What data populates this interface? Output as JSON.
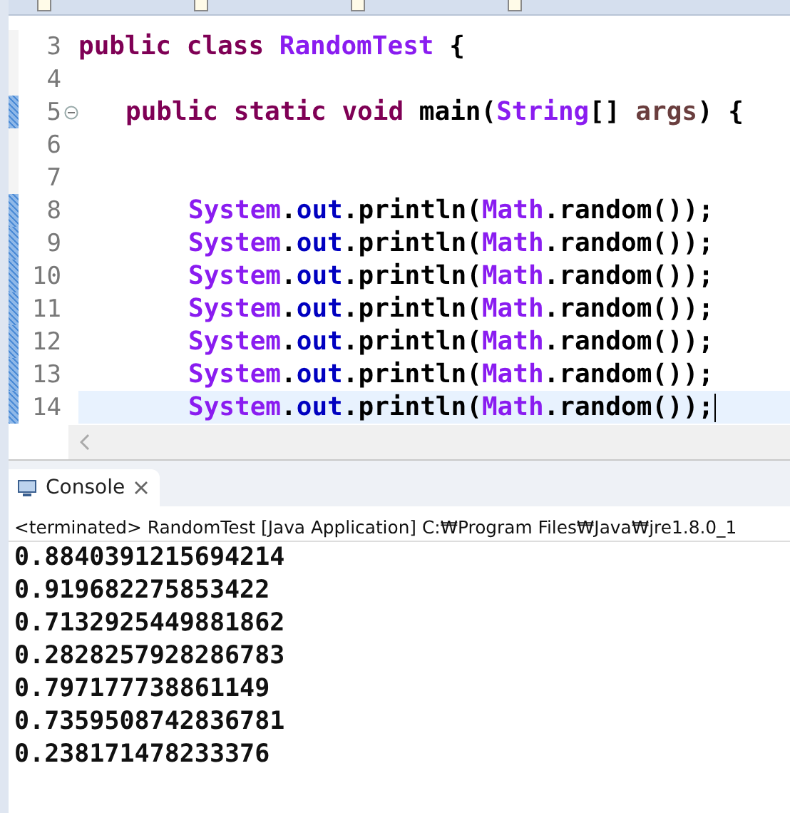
{
  "editor": {
    "lines": [
      {
        "number": "3",
        "changed": false,
        "fold": false,
        "current": false,
        "tokens": [
          {
            "text": "public",
            "kind": "keyword",
            "gap": false
          },
          {
            "text": "class",
            "kind": "keyword",
            "gap": true
          },
          {
            "text": "RandomTest",
            "kind": "type",
            "gap": true
          },
          {
            "text": "{",
            "kind": "plain",
            "gap": true
          }
        ],
        "children": [
          {
            "number": "4",
            "changed": false,
            "fold": false,
            "current": false
          },
          {
            "number": "5",
            "changed": true,
            "fold": true,
            "current": false,
            "tokens": [
              {
                "text": "public",
                "kind": "keyword",
                "gap": false
              },
              {
                "text": "static",
                "kind": "keyword",
                "gap": true
              },
              {
                "text": "void",
                "kind": "keyword",
                "gap": true
              },
              {
                "text": "main(",
                "kind": "plain",
                "gap": true
              },
              {
                "text": "String",
                "kind": "type",
                "gap": false
              },
              {
                "text": "[]",
                "kind": "plain",
                "gap": false
              },
              {
                "text": "args",
                "kind": "param",
                "gap": true
              },
              {
                "text": ")",
                "kind": "plain",
                "gap": false
              },
              {
                "text": "{",
                "kind": "plain",
                "gap": true
              }
            ],
            "children": [
              {
                "number": "6",
                "changed": false,
                "fold": false,
                "current": false
              },
              {
                "number": "7",
                "changed": false,
                "fold": false,
                "current": false
              },
              {
                "number": "8",
                "changed": true,
                "fold": false,
                "current": false,
                "tokens": [
                  {
                    "text": "System",
                    "kind": "type",
                    "gap": false
                  },
                  {
                    "text": ".",
                    "kind": "plain",
                    "gap": false
                  },
                  {
                    "text": "out",
                    "kind": "field",
                    "gap": false
                  },
                  {
                    "text": ".println(",
                    "kind": "plain",
                    "gap": false
                  },
                  {
                    "text": "Math",
                    "kind": "type",
                    "gap": false
                  },
                  {
                    "text": ".random());",
                    "kind": "plain",
                    "gap": false
                  }
                ]
              },
              {
                "number": "9",
                "changed": true,
                "fold": false,
                "current": false,
                "tokens": [
                  {
                    "text": "System",
                    "kind": "type",
                    "gap": false
                  },
                  {
                    "text": ".",
                    "kind": "plain",
                    "gap": false
                  },
                  {
                    "text": "out",
                    "kind": "field",
                    "gap": false
                  },
                  {
                    "text": ".println(",
                    "kind": "plain",
                    "gap": false
                  },
                  {
                    "text": "Math",
                    "kind": "type",
                    "gap": false
                  },
                  {
                    "text": ".random());",
                    "kind": "plain",
                    "gap": false
                  }
                ]
              },
              {
                "number": "10",
                "changed": true,
                "fold": false,
                "current": false,
                "tokens": [
                  {
                    "text": "System",
                    "kind": "type",
                    "gap": false
                  },
                  {
                    "text": ".",
                    "kind": "plain",
                    "gap": false
                  },
                  {
                    "text": "out",
                    "kind": "field",
                    "gap": false
                  },
                  {
                    "text": ".println(",
                    "kind": "plain",
                    "gap": false
                  },
                  {
                    "text": "Math",
                    "kind": "type",
                    "gap": false
                  },
                  {
                    "text": ".random());",
                    "kind": "plain",
                    "gap": false
                  }
                ]
              },
              {
                "number": "11",
                "changed": true,
                "fold": false,
                "current": false,
                "tokens": [
                  {
                    "text": "System",
                    "kind": "type",
                    "gap": false
                  },
                  {
                    "text": ".",
                    "kind": "plain",
                    "gap": false
                  },
                  {
                    "text": "out",
                    "kind": "field",
                    "gap": false
                  },
                  {
                    "text": ".println(",
                    "kind": "plain",
                    "gap": false
                  },
                  {
                    "text": "Math",
                    "kind": "type",
                    "gap": false
                  },
                  {
                    "text": ".random());",
                    "kind": "plain",
                    "gap": false
                  }
                ]
              },
              {
                "number": "12",
                "changed": true,
                "fold": false,
                "current": false,
                "tokens": [
                  {
                    "text": "System",
                    "kind": "type",
                    "gap": false
                  },
                  {
                    "text": ".",
                    "kind": "plain",
                    "gap": false
                  },
                  {
                    "text": "out",
                    "kind": "field",
                    "gap": false
                  },
                  {
                    "text": ".println(",
                    "kind": "plain",
                    "gap": false
                  },
                  {
                    "text": "Math",
                    "kind": "type",
                    "gap": false
                  },
                  {
                    "text": ".random());",
                    "kind": "plain",
                    "gap": false
                  }
                ]
              },
              {
                "number": "13",
                "changed": true,
                "fold": false,
                "current": false,
                "tokens": [
                  {
                    "text": "System",
                    "kind": "type",
                    "gap": false
                  },
                  {
                    "text": ".",
                    "kind": "plain",
                    "gap": false
                  },
                  {
                    "text": "out",
                    "kind": "field",
                    "gap": false
                  },
                  {
                    "text": ".println(",
                    "kind": "plain",
                    "gap": false
                  },
                  {
                    "text": "Math",
                    "kind": "type",
                    "gap": false
                  },
                  {
                    "text": ".random());",
                    "kind": "plain",
                    "gap": false
                  }
                ]
              },
              {
                "number": "14",
                "changed": true,
                "fold": false,
                "current": true,
                "tokens": [
                  {
                    "text": "System",
                    "kind": "type",
                    "gap": false
                  },
                  {
                    "text": ".",
                    "kind": "plain",
                    "gap": false
                  },
                  {
                    "text": "out",
                    "kind": "field",
                    "gap": false
                  },
                  {
                    "text": ".println(",
                    "kind": "plain",
                    "gap": false
                  },
                  {
                    "text": "Math",
                    "kind": "type",
                    "gap": false
                  },
                  {
                    "text": ".random());",
                    "kind": "plain",
                    "gap": false
                  }
                ]
              }
            ]
          }
        ]
      }
    ]
  },
  "console": {
    "tab": {
      "label": "Console",
      "selected": true
    },
    "header": "<terminated> RandomTest [Java Application] C:₩Program Files₩Java₩jre1.8.0_1",
    "output": [
      "0.8840391215694214",
      "0.919682275853422",
      "0.7132925449881862",
      "0.2828257928286783",
      "0.797177738861149",
      "0.7359508742836781",
      "0.238171478233376"
    ]
  }
}
